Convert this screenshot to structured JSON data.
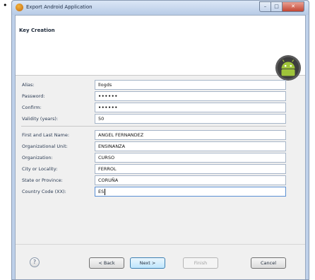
{
  "bullet": "•",
  "window": {
    "title": "Export Android Application",
    "controls": {
      "minimize": "–",
      "maximize": "□",
      "close": "✕"
    }
  },
  "banner": {
    "title": "Key Creation",
    "logo_icon": "android-logo-icon"
  },
  "form": {
    "alias": {
      "label": "Alias:",
      "value": "llogds"
    },
    "password": {
      "label": "Password:",
      "value": "••••••"
    },
    "confirm": {
      "label": "Confirm:",
      "value": "••••••"
    },
    "validity": {
      "label": "Validity (years):",
      "value": "50"
    },
    "name": {
      "label": "First and Last Name:",
      "value": "ANGEL FERNANDEZ"
    },
    "org_unit": {
      "label": "Organizational Unit:",
      "value": "ENSINANZA"
    },
    "organization": {
      "label": "Organization:",
      "value": "CURSO"
    },
    "city": {
      "label": "City or Locality:",
      "value": "FERROL"
    },
    "state": {
      "label": "State or Province:",
      "value": "CORUÑA"
    },
    "country": {
      "label": "Country Code (XX):",
      "value": "ES"
    }
  },
  "footer": {
    "help": "?",
    "back": "< Back",
    "next": "Next >",
    "finish": "Finish",
    "cancel": "Cancel"
  },
  "colors": {
    "titlebar": "#b7cbe6",
    "default_button": "#bee6fd",
    "android_green": "#9fc43a"
  }
}
